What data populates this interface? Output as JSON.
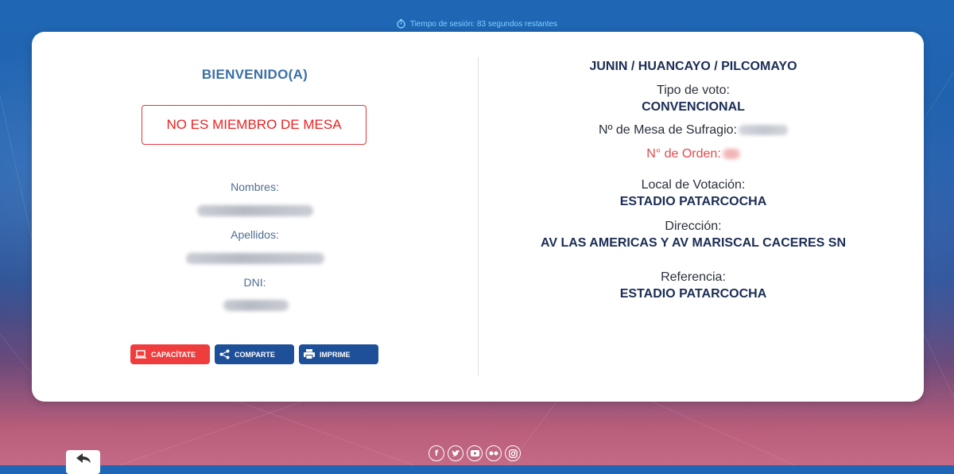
{
  "session": {
    "text": "Tiempo de sesión: 83 segundos restantes"
  },
  "left": {
    "welcome": "BIENVENIDO(A)",
    "member_status": "NO ES MIEMBRO DE MESA",
    "nombres_label": "Nombres:",
    "apellidos_label": "Apellidos:",
    "dni_label": "DNI:"
  },
  "buttons": {
    "capacitate": "CAPACÍTATE",
    "comparte": "COMPARTE",
    "imprime": "IMPRIME"
  },
  "right": {
    "location": "JUNIN / HUANCAYO / PILCOMAYO",
    "tipo_voto_label": "Tipo de voto:",
    "tipo_voto_value": "CONVENCIONAL",
    "mesa_label": "Nº de Mesa de Sufragio:",
    "orden_label": "N° de Orden:",
    "local_label": "Local de Votación:",
    "local_value": "ESTADIO PATARCOCHA",
    "direccion_label": "Dirección:",
    "direccion_value": "AV LAS AMERICAS Y AV MARISCAL CACERES SN",
    "referencia_label": "Referencia:",
    "referencia_value": "ESTADIO PATARCOCHA"
  },
  "socials": [
    "facebook-icon",
    "twitter-icon",
    "youtube-icon",
    "flickr-icon",
    "instagram-icon"
  ],
  "colors": {
    "accent_blue": "#1e4f99",
    "accent_red": "#ef3d3d",
    "heading_blue": "#3a6ea8",
    "dark_navy": "#1b2d55"
  }
}
